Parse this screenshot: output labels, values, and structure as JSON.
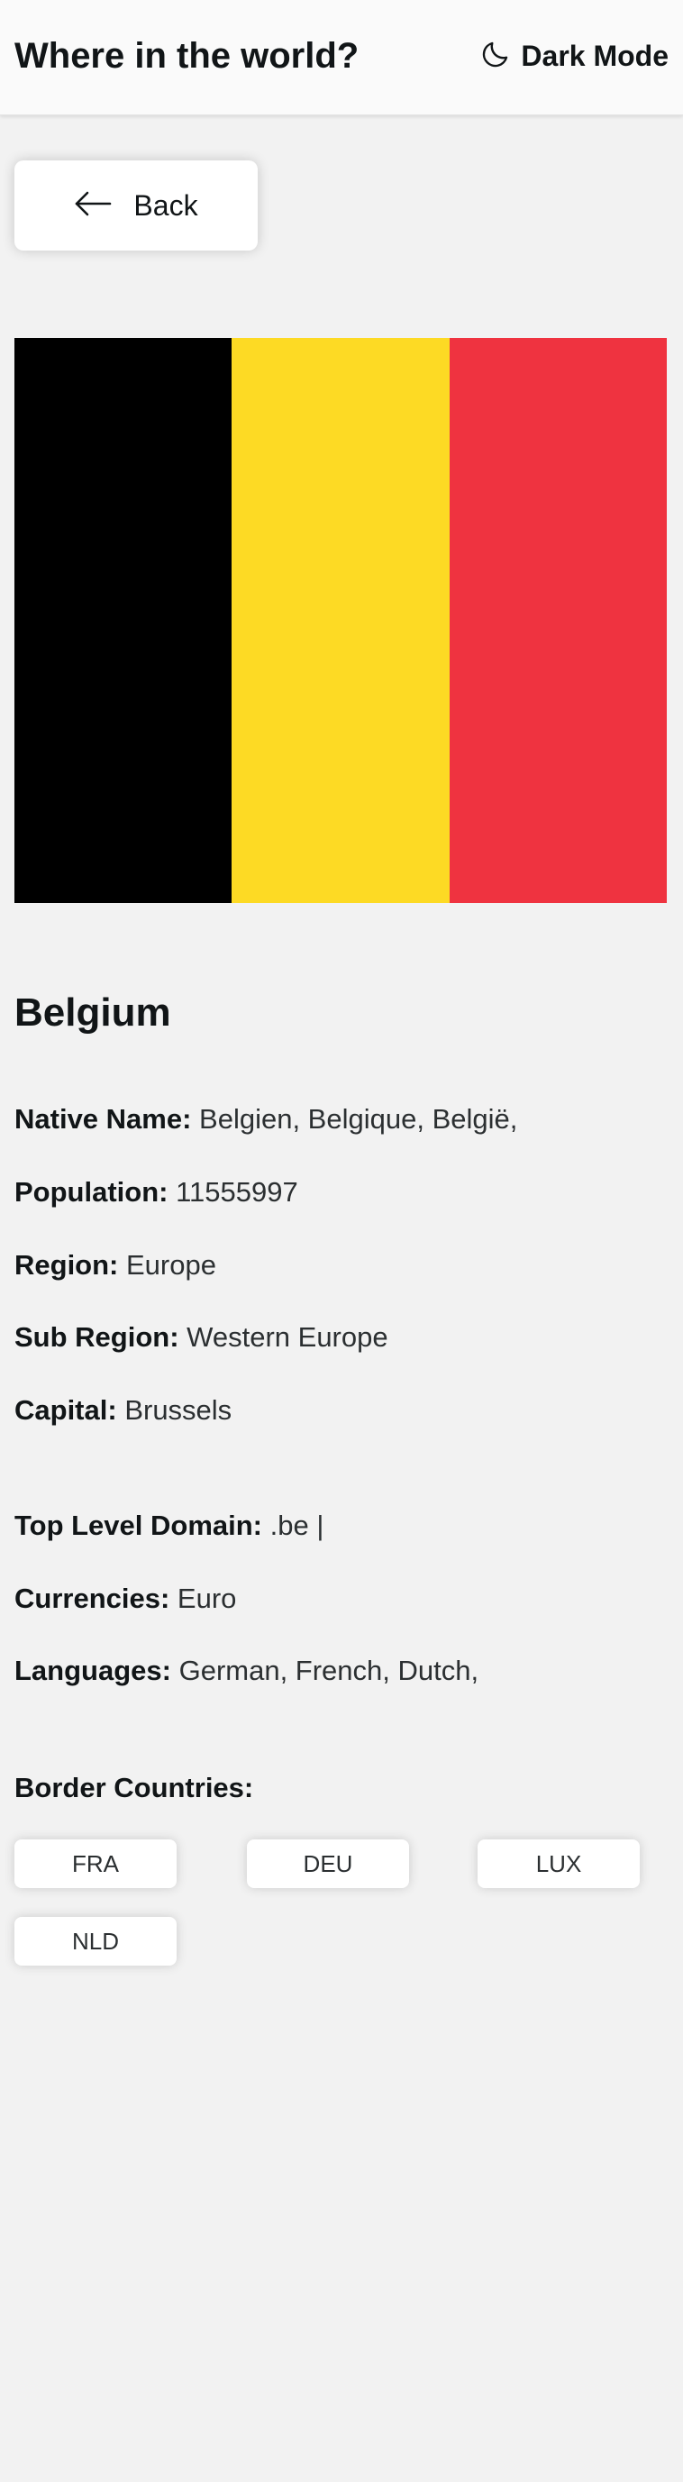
{
  "header": {
    "title": "Where in the world?",
    "theme_toggle_label": "Dark Mode",
    "theme_toggle_icon": "moon-icon"
  },
  "back_button": {
    "label": "Back",
    "icon": "arrow-left-icon"
  },
  "flag": {
    "country": "Belgium",
    "colors": [
      "#000000",
      "#FDDA24",
      "#EF3340"
    ]
  },
  "country": {
    "name": "Belgium",
    "native_name": {
      "label": "Native Name:",
      "value": "Belgien, Belgique, België,"
    },
    "population": {
      "label": "Population:",
      "value": "11555997"
    },
    "region": {
      "label": "Region:",
      "value": "Europe"
    },
    "sub_region": {
      "label": "Sub Region:",
      "value": "Western Europe"
    },
    "capital": {
      "label": "Capital:",
      "value": "Brussels"
    },
    "top_level_domain": {
      "label": "Top Level Domain:",
      "value": ".be |"
    },
    "currencies": {
      "label": "Currencies:",
      "value": "Euro"
    },
    "languages": {
      "label": "Languages:",
      "value": "German, French, Dutch,"
    }
  },
  "borders": {
    "title": "Border Countries:",
    "countries": [
      "FRA",
      "DEU",
      "LUX",
      "NLD"
    ]
  },
  "colors": {
    "background": "#f2f2f2",
    "header_background": "#fafafa",
    "element_background": "#ffffff",
    "text": "#111517"
  }
}
